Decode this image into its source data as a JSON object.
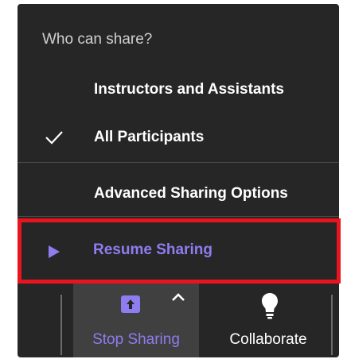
{
  "menu": {
    "title": "Who can share?",
    "items": [
      {
        "label": "Instructors and Assistants",
        "checked": false
      },
      {
        "label": "All Participants",
        "checked": true
      },
      {
        "label": "Advanced Sharing Options",
        "checked": false
      }
    ],
    "resume": {
      "label": "Resume Sharing",
      "icon": "play-icon"
    }
  },
  "toolbar": {
    "stop_sharing": {
      "label": "Stop Sharing",
      "icon": "share-screen-icon"
    },
    "collaborate": {
      "label": "Collaborate",
      "icon": "lightbulb-icon"
    }
  },
  "colors": {
    "menu_background": "#262626",
    "accent": "#8d7df0",
    "highlight_border": "#e8141e",
    "active_button_background": "#404040"
  }
}
